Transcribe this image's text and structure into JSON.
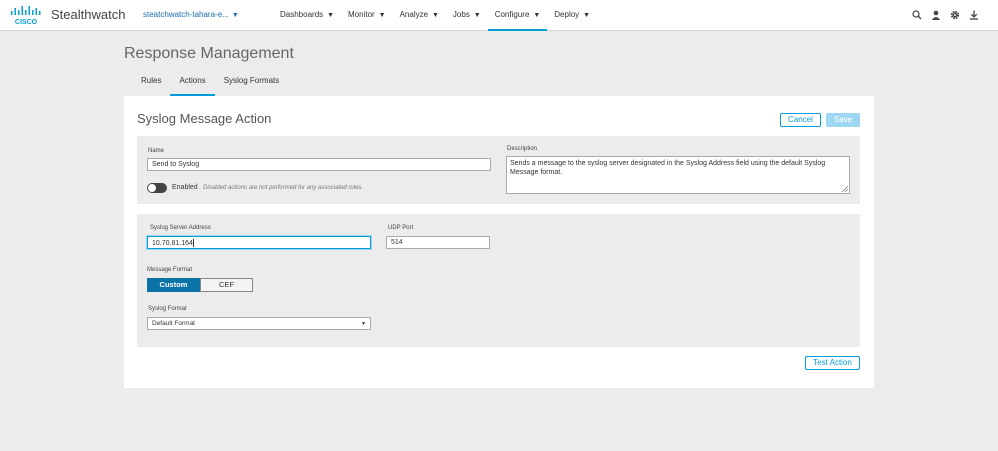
{
  "header": {
    "app_title": "Stealthwatch",
    "domain": "steatchwatch-tahara-e...",
    "nav": [
      {
        "label": "Dashboards"
      },
      {
        "label": "Monitor"
      },
      {
        "label": "Analyze"
      },
      {
        "label": "Jobs"
      },
      {
        "label": "Configure"
      },
      {
        "label": "Deploy"
      }
    ],
    "active_nav": "Configure",
    "icons": [
      "search-icon",
      "user-icon",
      "gear-icon",
      "download-icon"
    ]
  },
  "page": {
    "title": "Response Management",
    "tabs": [
      {
        "label": "Rules"
      },
      {
        "label": "Actions"
      },
      {
        "label": "Syslog Formats"
      }
    ],
    "active_tab": "Actions"
  },
  "card": {
    "title": "Syslog Message Action",
    "cancel_label": "Cancel",
    "save_label": "Save",
    "test_label": "Test Action"
  },
  "form": {
    "name_label": "Name",
    "name_value": "Send to Syslog",
    "description_label": "Description",
    "description_value": "Sends a message to the syslog server designated in the Syslog Address field using the default Syslog Message format.",
    "enabled_label": "Enabled",
    "enabled_hint": "Disabled actions are not performed for any associated rules.",
    "enabled": false,
    "server_label": "Syslog Server Address",
    "server_value": "10.70.81.164",
    "port_label": "UDP Port",
    "port_value": "514",
    "format_label": "Message Format",
    "format_options": [
      "Custom",
      "CEF"
    ],
    "format_selected": "Custom",
    "syslog_format_label": "Syslog Format",
    "syslog_format_value": "Default Format"
  },
  "colors": {
    "accent": "#049fd9",
    "segment_active": "#0c73a8",
    "save_disabled": "#9ed7f2"
  }
}
